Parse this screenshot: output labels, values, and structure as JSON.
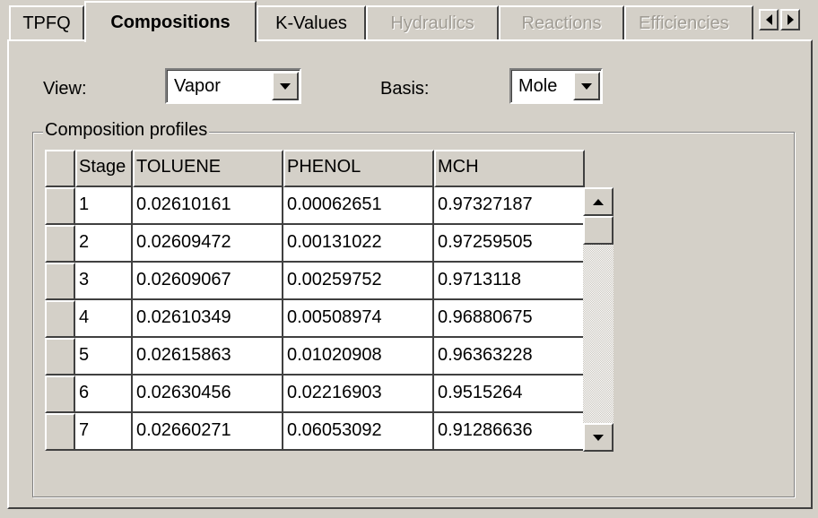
{
  "tabs": [
    {
      "label": "TPFQ",
      "state": "normal"
    },
    {
      "label": "Compositions",
      "state": "active"
    },
    {
      "label": "K-Values",
      "state": "normal"
    },
    {
      "label": "Hydraulics",
      "state": "disabled"
    },
    {
      "label": "Reactions",
      "state": "disabled"
    },
    {
      "label": "Efficiencies",
      "state": "disabled"
    }
  ],
  "controls": {
    "view_label": "View:",
    "view_value": "Vapor",
    "basis_label": "Basis:",
    "basis_value": "Mole"
  },
  "group": {
    "title": "Composition profiles"
  },
  "table": {
    "columns": [
      "Stage",
      "TOLUENE",
      "PHENOL",
      "MCH"
    ],
    "rows": [
      [
        "1",
        "0.02610161",
        "0.00062651",
        "0.97327187"
      ],
      [
        "2",
        "0.02609472",
        "0.00131022",
        "0.97259505"
      ],
      [
        "3",
        "0.02609067",
        "0.00259752",
        "0.9713118"
      ],
      [
        "4",
        "0.02610349",
        "0.00508974",
        "0.96880675"
      ],
      [
        "5",
        "0.02615863",
        "0.01020908",
        "0.96363228"
      ],
      [
        "6",
        "0.02630456",
        "0.02216903",
        "0.9515264"
      ],
      [
        "7",
        "0.02660271",
        "0.06053092",
        "0.91286636"
      ]
    ]
  },
  "icons": {
    "tab_scroll_left": "triangle-left-icon",
    "tab_scroll_right": "triangle-right-icon",
    "dropdown": "chevron-down-icon",
    "scroll_up": "triangle-up-icon",
    "scroll_down": "triangle-down-icon"
  },
  "colors": {
    "face": "#d4d0c8",
    "highlight": "#ffffff",
    "shadow": "#404040",
    "disabled_text": "#a09c94"
  }
}
